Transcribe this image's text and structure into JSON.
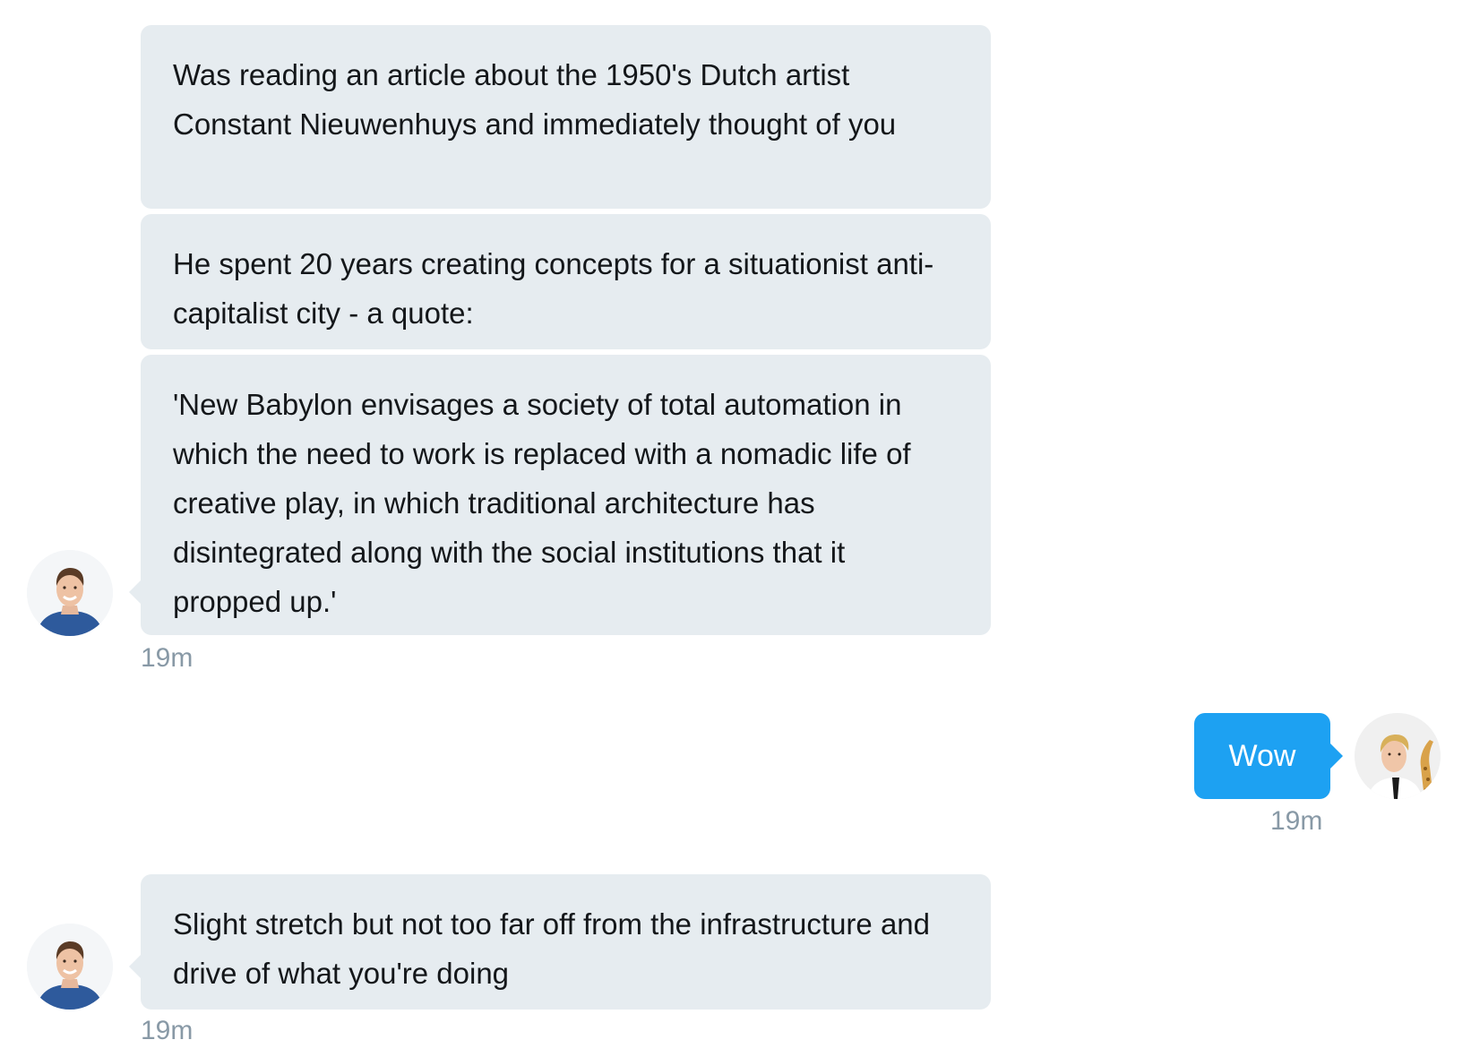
{
  "conversation": {
    "messages": [
      {
        "sender": "other",
        "text": "Was reading an article about the 1950's Dutch artist Constant Nieuwenhuys and immediately thought of you"
      },
      {
        "sender": "other",
        "text": "He spent 20 years creating concepts for a situationist anti-capitalist city - a quote:"
      },
      {
        "sender": "other",
        "text": "'New Babylon envisages a society of total automation in which the need to work is replaced with a nomadic life of creative play, in which traditional architecture has disintegrated along with the social institutions that it propped up.'"
      },
      {
        "sender": "me",
        "text": "Wow"
      },
      {
        "sender": "other",
        "text": "Slight stretch but not too far off from the infrastructure and drive of what you're doing"
      }
    ],
    "timestamps": {
      "group1": "19m",
      "reply": "19m",
      "group2": "19m"
    },
    "colors": {
      "received_bubble": "#e6ecf0",
      "sent_bubble": "#1da1f2",
      "timestamp": "#8899a6"
    },
    "icons": {
      "other_avatar": "avatar-man-blue-sweater-icon",
      "my_avatar": "avatar-man-tie-giraffe-icon"
    }
  }
}
